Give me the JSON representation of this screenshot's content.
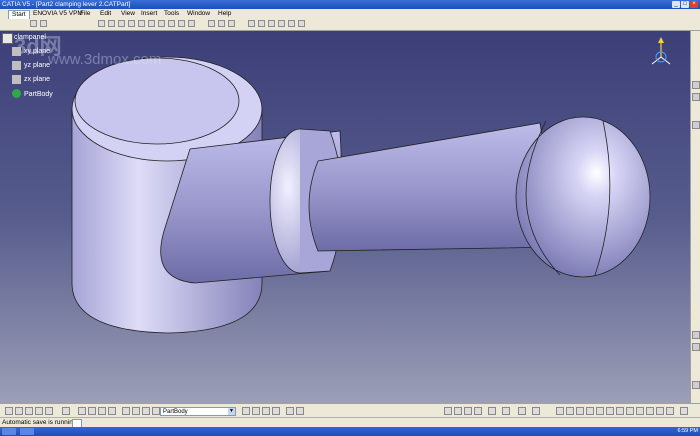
{
  "window": {
    "title": "CATIA V5 - [Part2 clamping lever 2.CATPart]"
  },
  "menu": {
    "start": "Start",
    "items": [
      "ENOVIA V5 VPM",
      "File",
      "Edit",
      "View",
      "Insert",
      "Tools",
      "Window",
      "Help"
    ]
  },
  "tree": {
    "root": "clampanel",
    "children": [
      "xy plane",
      "yz plane",
      "zx plane",
      "PartBody"
    ]
  },
  "watermark": {
    "main": "3d网",
    "sub": "www.3dmox.com"
  },
  "bottom_toolbar": {
    "current_body": "PartBody"
  },
  "status": {
    "message": "Automatic save is running..."
  },
  "taskbar": {
    "clock": "6:59 PM"
  },
  "colors": {
    "viewport_top": "#3c3f78",
    "viewport_bottom": "#9c9fb6",
    "model_fill": "#c9c8ee"
  }
}
